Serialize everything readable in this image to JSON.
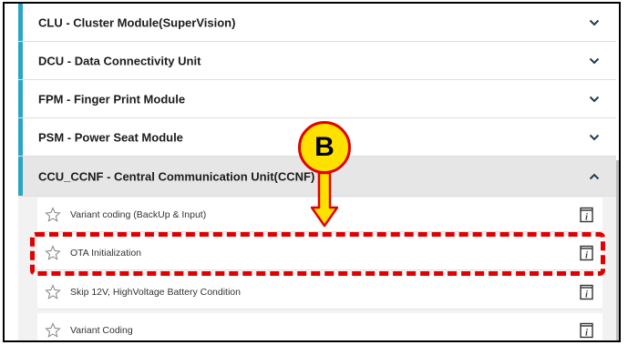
{
  "modules": [
    {
      "label": "CLU - Cluster Module(SuperVision)",
      "expanded": false
    },
    {
      "label": "DCU - Data Connectivity Unit",
      "expanded": false
    },
    {
      "label": "FPM - Finger Print Module",
      "expanded": false
    },
    {
      "label": "PSM - Power Seat Module",
      "expanded": false
    },
    {
      "label": "CCU_CCNF - Central Communication Unit(CCNF)",
      "expanded": true
    }
  ],
  "items": [
    {
      "label": "Variant coding (BackUp & Input)"
    },
    {
      "label": "OTA Initialization"
    },
    {
      "label": "Skip 12V, HighVoltage Battery Condition"
    },
    {
      "label": "Variant Coding"
    }
  ],
  "annotation": {
    "callout_letter": "B",
    "highlight_color": "#e10000",
    "callout_fill": "#ffe100"
  },
  "colors": {
    "accent": "#2aa6c4"
  },
  "icons": {
    "collapse": "chevron-down-icon",
    "expand": "chevron-up-icon",
    "favorite": "star-outline-icon",
    "info": "info-icon"
  }
}
